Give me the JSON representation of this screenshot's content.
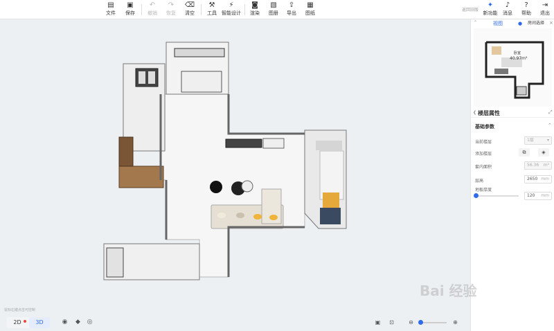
{
  "toolbar": {
    "items": [
      {
        "label": "文件",
        "icon": "file-icon"
      },
      {
        "label": "保存",
        "icon": "save-icon"
      },
      {
        "label": "撤销",
        "icon": "undo-icon"
      },
      {
        "label": "恢复",
        "icon": "redo-icon"
      },
      {
        "label": "清空",
        "icon": "clear-icon"
      },
      {
        "label": "工具",
        "icon": "tools-icon"
      },
      {
        "label": "智能设计",
        "icon": "smart-design-icon"
      },
      {
        "label": "渲染",
        "icon": "render-icon"
      },
      {
        "label": "图册",
        "icon": "album-icon"
      },
      {
        "label": "导出",
        "icon": "export-icon"
      },
      {
        "label": "图纸",
        "icon": "drawings-icon"
      }
    ],
    "back_link": "返回旧版",
    "right": [
      {
        "label": "新功能",
        "icon": "new-feature-icon"
      },
      {
        "label": "消息",
        "icon": "bell-icon"
      },
      {
        "label": "帮助",
        "icon": "help-icon"
      },
      {
        "label": "退出",
        "icon": "logout-icon"
      }
    ]
  },
  "preview": {
    "tabs": [
      "视图",
      "房间选择"
    ],
    "room_label": "卧室",
    "area": "40.97m²"
  },
  "panel": {
    "title": "楼层属性",
    "section": "基础参数",
    "rows": {
      "current_floor": {
        "label": "当前楼层",
        "value": "1层"
      },
      "add_floor": {
        "label": "添加楼层"
      },
      "indoor_area": {
        "label": "套内面积",
        "value": "56.36",
        "unit": "m²"
      },
      "floor_height": {
        "label": "层高",
        "value": "2650",
        "unit": "mm"
      },
      "slab_thickness": {
        "label": "地板厚度",
        "value": "120",
        "unit": "mm"
      }
    }
  },
  "canvas": {
    "footer_hint": "鼠标右键点击可控制",
    "view_2d": "2D",
    "view_3d": "3D"
  },
  "watermark": "Bai 经验",
  "colors": {
    "accent": "#2f6bea",
    "canvas_bg": "#ecf0f3"
  }
}
